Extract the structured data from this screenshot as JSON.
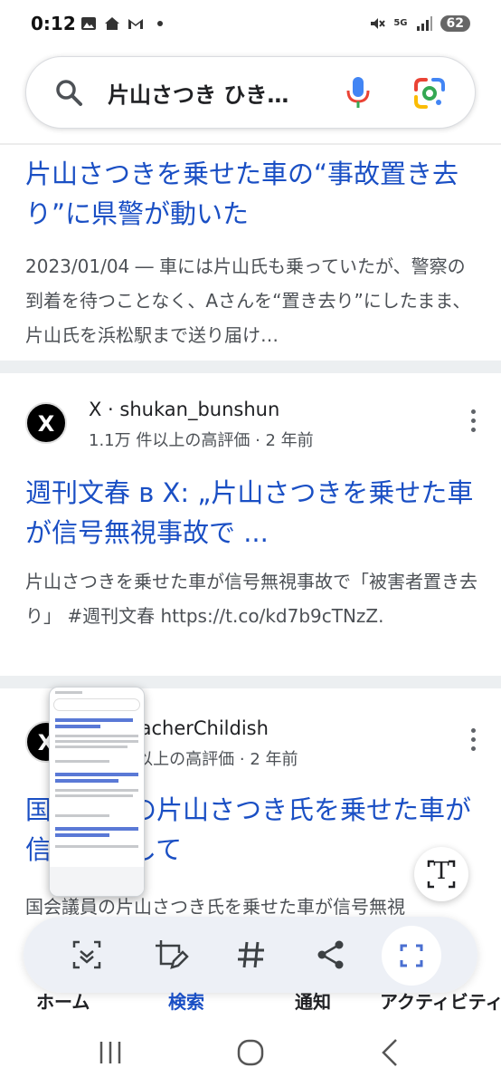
{
  "status_bar": {
    "time": "0:12",
    "network": "5G",
    "battery": "62"
  },
  "search": {
    "query": "片山さつき ひき…"
  },
  "results": [
    {
      "title": "片山さつきを乗せた車の“事故置き去り”に県警が動いた",
      "snippet": "2023/01/04 ― 車には片山氏も乗っていたが、警察の到着を待つことなく、Aさんを“置き去り”にしたまま、片山氏を浜松駅まで送り届け…"
    },
    {
      "site_name": "X · shukan_bunshun",
      "meta": "1.1万 件以上の高評価 · 2 年前",
      "title": "週刊文春 в X: „片山さつきを乗せた車が信号無視事故で ...",
      "snippet": "片山さつきを乗せた車が信号無視事故で「被害者置き去り」 #週刊文春 https://t.co/kd7b9cTNzZ."
    },
    {
      "site_name": "X · TeacherChildish",
      "meta": "1万 件以上の高評価 · 2 年前",
      "title": "国会議員の片山さつき氏を乗せた車が信号無視して",
      "snippet": "国会議員の片山さつき氏を乗せた車が信号無視"
    }
  ],
  "fab": {
    "label": "T"
  },
  "bottom_nav": [
    "ホーム",
    "検索",
    "通知",
    "アクティビティ"
  ],
  "colors": {
    "link": "#1a4fc4",
    "snippet": "#4d5156",
    "toolbar": "#eceff6"
  }
}
